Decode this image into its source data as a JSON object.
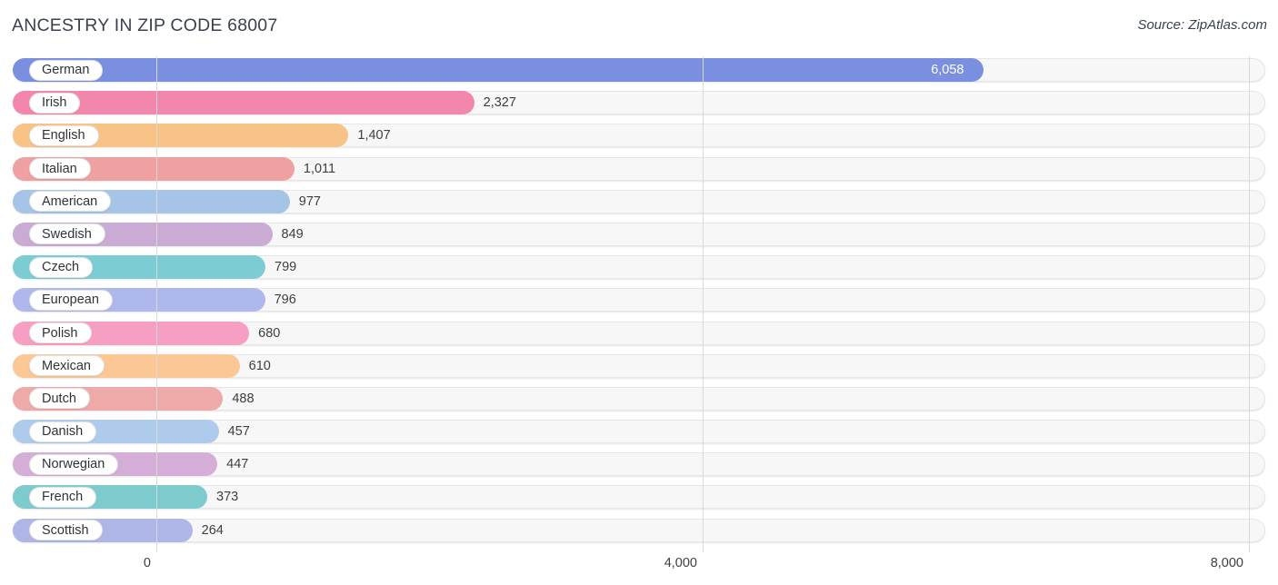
{
  "header": {
    "title": "ANCESTRY IN ZIP CODE 68007",
    "source": "Source: ZipAtlas.com"
  },
  "chart_data": {
    "type": "bar",
    "orientation": "horizontal",
    "title": "ANCESTRY IN ZIP CODE 68007",
    "subtitle": "Source: ZipAtlas.com",
    "xlabel": "",
    "ylabel": "",
    "xlim": [
      0,
      8000
    ],
    "xticks": [
      0,
      4000,
      8000
    ],
    "xtick_labels": [
      "0",
      "4,000",
      "8,000"
    ],
    "grid": true,
    "legend": false,
    "categories": [
      "German",
      "Irish",
      "English",
      "Italian",
      "American",
      "Swedish",
      "Czech",
      "European",
      "Polish",
      "Mexican",
      "Dutch",
      "Danish",
      "Norwegian",
      "French",
      "Scottish"
    ],
    "values": [
      6058,
      2327,
      1407,
      1011,
      977,
      849,
      799,
      796,
      680,
      610,
      488,
      457,
      447,
      373,
      264
    ],
    "value_labels": [
      "6,058",
      "2,327",
      "1,407",
      "1,011",
      "977",
      "849",
      "799",
      "796",
      "680",
      "610",
      "488",
      "457",
      "447",
      "373",
      "264"
    ],
    "colors": [
      "#7b8fe0",
      "#f286ad",
      "#f8c386",
      "#efa0a0",
      "#a5c4e8",
      "#c9abd3",
      "#7ccdd3",
      "#aeb8ec",
      "#f79fc2",
      "#fac795",
      "#eeaaa8",
      "#afcbec",
      "#d4aed6",
      "#7ecbcd",
      "#aeb6e8"
    ],
    "bars": [
      {
        "label": "German",
        "value": 6058,
        "value_label": "6,058",
        "color": "#7b8fe0",
        "label_inside": true
      },
      {
        "label": "Irish",
        "value": 2327,
        "value_label": "2,327",
        "color": "#f286ad",
        "label_inside": false
      },
      {
        "label": "English",
        "value": 1407,
        "value_label": "1,407",
        "color": "#f8c386",
        "label_inside": false
      },
      {
        "label": "Italian",
        "value": 1011,
        "value_label": "1,011",
        "color": "#efa0a0",
        "label_inside": false
      },
      {
        "label": "American",
        "value": 977,
        "value_label": "977",
        "color": "#a5c4e8",
        "label_inside": false
      },
      {
        "label": "Swedish",
        "value": 849,
        "value_label": "849",
        "color": "#c9abd3",
        "label_inside": false
      },
      {
        "label": "Czech",
        "value": 799,
        "value_label": "799",
        "color": "#7ccdd3",
        "label_inside": false
      },
      {
        "label": "European",
        "value": 796,
        "value_label": "796",
        "color": "#aeb8ec",
        "label_inside": false
      },
      {
        "label": "Polish",
        "value": 680,
        "value_label": "680",
        "color": "#f79fc2",
        "label_inside": false
      },
      {
        "label": "Mexican",
        "value": 610,
        "value_label": "610",
        "color": "#fac795",
        "label_inside": false
      },
      {
        "label": "Dutch",
        "value": 488,
        "value_label": "488",
        "color": "#eeaaa8",
        "label_inside": false
      },
      {
        "label": "Danish",
        "value": 457,
        "value_label": "457",
        "color": "#afcbec",
        "label_inside": false
      },
      {
        "label": "Norwegian",
        "value": 447,
        "value_label": "447",
        "color": "#d4aed6",
        "label_inside": false
      },
      {
        "label": "French",
        "value": 373,
        "value_label": "373",
        "color": "#7ecbcd",
        "label_inside": false
      },
      {
        "label": "Scottish",
        "value": 264,
        "value_label": "264",
        "color": "#aeb6e8",
        "label_inside": false
      }
    ]
  }
}
